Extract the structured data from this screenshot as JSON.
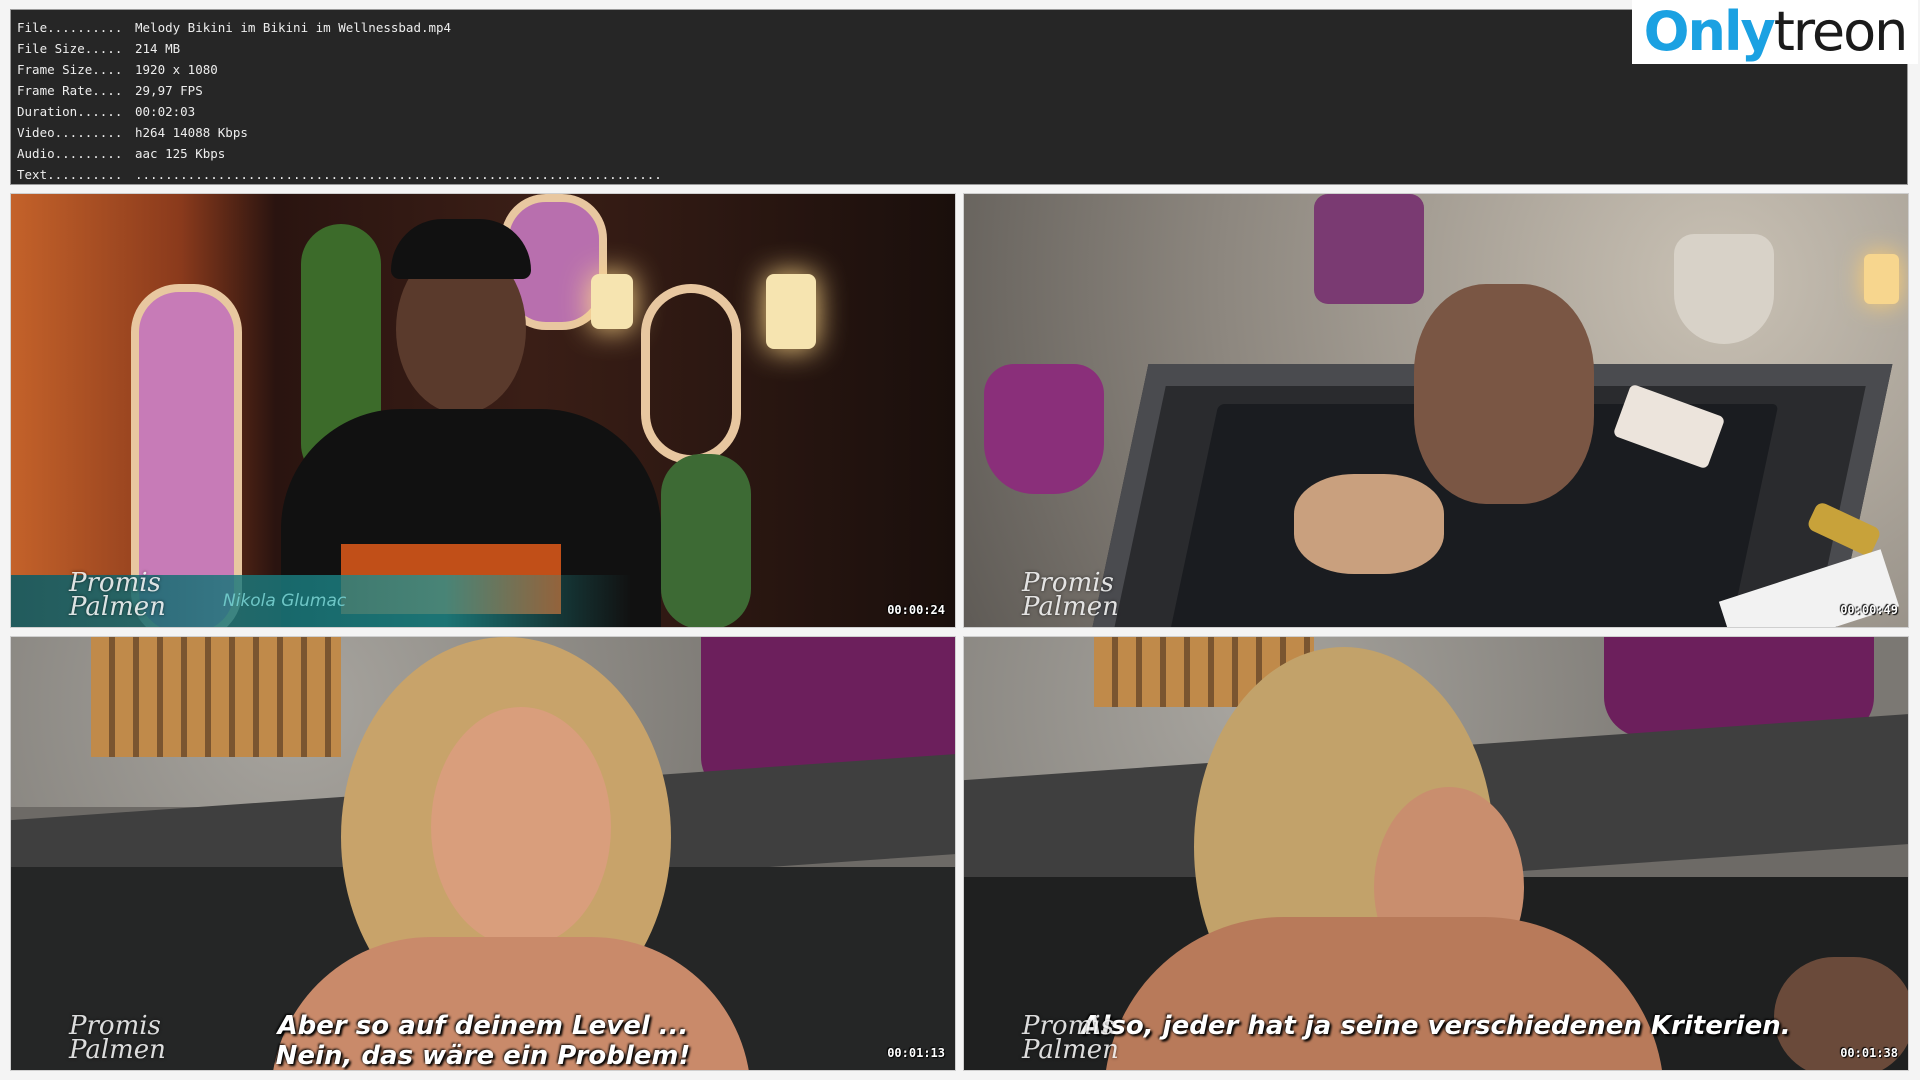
{
  "info": {
    "lines": [
      {
        "label": "File..........",
        "value": "Melody Bikini im Bikini im Wellnessbad.mp4"
      },
      {
        "label": "File Size.....",
        "value": "214 MB"
      },
      {
        "label": "Frame Size....",
        "value": "1920 x 1080"
      },
      {
        "label": "Frame Rate....",
        "value": "29,97 FPS"
      },
      {
        "label": "Duration......",
        "value": "00:02:03"
      },
      {
        "label": "Video.........",
        "value": "h264 14088 Kbps"
      },
      {
        "label": "Audio.........",
        "value": "aac 125 Kbps"
      },
      {
        "label": "Text..........",
        "value": "......................................................................"
      }
    ]
  },
  "watermark": {
    "part1": "Only",
    "part2": "treon"
  },
  "thumbnails": [
    {
      "timestamp": "00:00:24",
      "show_logo": "Promis Palmen",
      "name_tag": "Nikola Glumac",
      "subtitle_1": "",
      "subtitle_2": ""
    },
    {
      "timestamp": "00:00:49",
      "show_logo": "Promis Palmen",
      "name_tag": "",
      "subtitle_1": "",
      "subtitle_2": ""
    },
    {
      "timestamp": "00:01:13",
      "show_logo": "Promis Palmen",
      "name_tag": "",
      "subtitle_1": "Aber so auf deinem Level ...",
      "subtitle_2": "Nein, das wäre ein Problem!"
    },
    {
      "timestamp": "00:01:38",
      "show_logo": "Promis Palmen",
      "name_tag": "",
      "subtitle_1": "Also, jeder hat ja seine verschiedenen Kriterien.",
      "subtitle_2": ""
    }
  ]
}
